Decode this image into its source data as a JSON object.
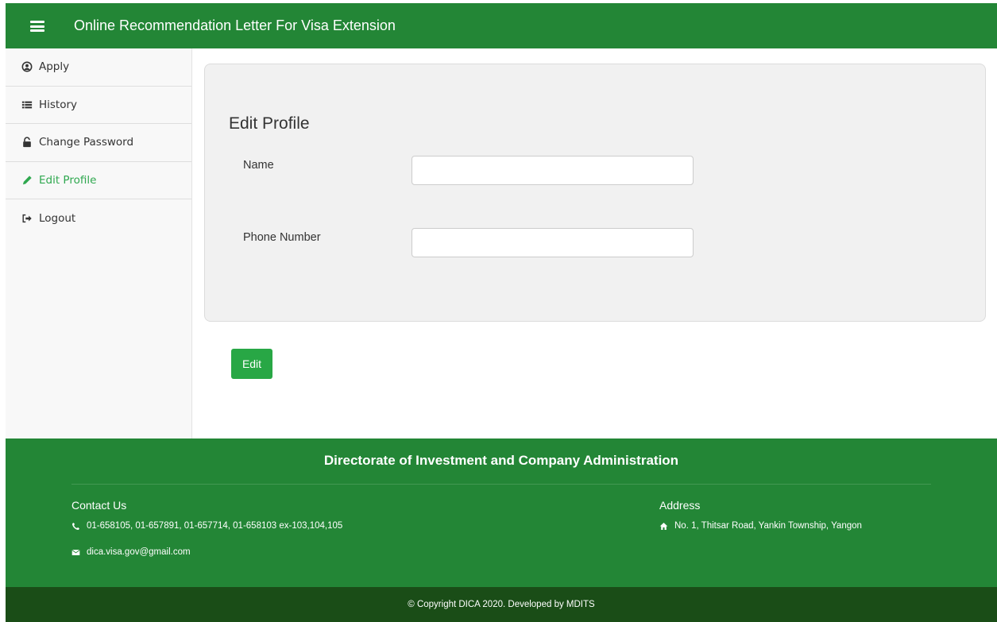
{
  "header": {
    "menu_icon": "hamburger-menu-icon",
    "title": "Online Recommendation Letter For Visa Extension"
  },
  "sidebar": {
    "items": [
      {
        "label": "Apply",
        "icon": "user-circle-icon",
        "active": false
      },
      {
        "label": "History",
        "icon": "list-icon",
        "active": false
      },
      {
        "label": "Change Password",
        "icon": "unlock-icon",
        "active": false
      },
      {
        "label": "Edit Profile",
        "icon": "pencil-icon",
        "active": true
      },
      {
        "label": "Logout",
        "icon": "sign-out-icon",
        "active": false
      }
    ]
  },
  "form": {
    "title": "Edit Profile",
    "name_label": "Name",
    "name_value": "",
    "phone_label": "Phone Number",
    "phone_value": "",
    "submit_label": "Edit"
  },
  "footer": {
    "heading": "Directorate of Investment and Company Administration",
    "contact_title": "Contact Us",
    "phone": "01-658105, 01-657891, 01-657714, 01-658103 ex-103,104,105",
    "email": "dica.visa.gov@gmail.com",
    "address_title": "Address",
    "address": "No. 1, Thitsar Road, Yankin Township, Yangon",
    "copyright": "© Copyright DICA 2020. Developed by MDITS"
  },
  "colors": {
    "brand_green": "#238636",
    "button_green": "#28a745",
    "active_item": "#2fa84f",
    "copyright_bar": "#1a4d17"
  }
}
